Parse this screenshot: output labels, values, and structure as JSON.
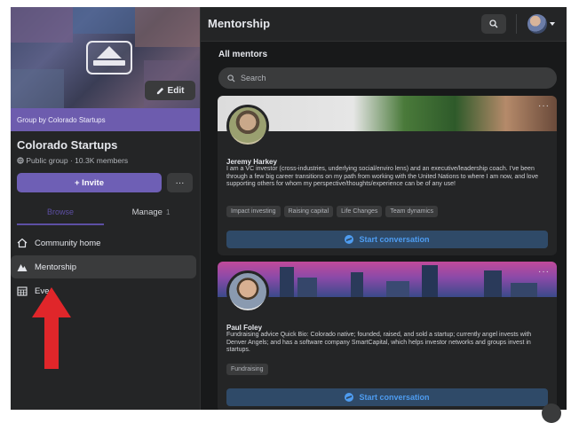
{
  "sidebar": {
    "edit_label": "Edit",
    "group_by": "Group by Colorado Startups",
    "group_name": "Colorado Startups",
    "group_meta": "Public group · 10.3K members",
    "invite_label": "+ Invite",
    "more_label": "···",
    "tab_browse": "Browse",
    "tab_manage": "Manage",
    "tab_manage_count": "1",
    "nav": [
      {
        "label": "Community home",
        "icon": "house-icon"
      },
      {
        "label": "Mentorship",
        "icon": "mountain-icon"
      },
      {
        "label": "Eve",
        "icon": "calendar-icon"
      }
    ]
  },
  "header": {
    "title": "Mentorship"
  },
  "main": {
    "section_title": "All mentors",
    "search_placeholder": "Search",
    "mentors": [
      {
        "name": "Jeremy Harkey",
        "bio": "I am a VC investor (cross-industries, underlying social/enviro lens) and an executive/leadership coach. I've been through a few big career transitions on my path from working with the United Nations to where I am now, and love supporting others for whom my perspective/thoughts/experience can be of any use!",
        "tags": [
          "Impact investing",
          "Raising capital",
          "Life Changes",
          "Team dynamics"
        ],
        "cta": "Start conversation"
      },
      {
        "name": "Paul Foley",
        "bio": "Fundraising advice Quick Bio: Colorado native; founded, raised, and sold a startup; currently angel invests with Denver Angels; and has a software company SmartCapital, which helps investor networks and groups invest in startups.",
        "tags": [
          "Fundraising"
        ],
        "cta": "Start conversation"
      }
    ]
  },
  "colors": {
    "accent": "#6d5cae",
    "background": "#18191a",
    "surface": "#242526",
    "cta_text": "#4e9cf0",
    "arrow": "#e0262a"
  }
}
